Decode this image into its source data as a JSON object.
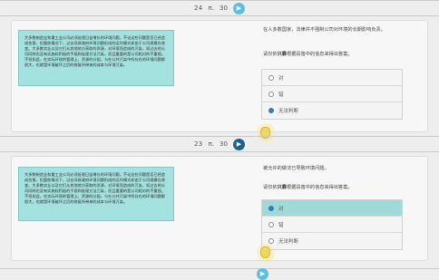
{
  "accent_color": "#5bbfe3",
  "active_color": "#1f5f8a",
  "passage_bg": "#a4e2df",
  "questions": [
    {
      "header": {
        "number": "24",
        "separator": "π.",
        "total": "30",
        "play_icon": "play-icon"
      },
      "passage": "大多数制造业和重工业公司必须处理日益增长的环境问题。不论这些问题是否已经造成伤害，但要依情况下，过去导致政府环境问题形成的运作模式却由于公司规模在改变。大多数实业以及它们从其他地方获取的资源，对环境而造成的污染，如过去的公司同样也没有实施较积极的手段和处理方法污染，而且重要的是公司相对的不重视。不但如此，在实际环保的管理上，资源的分配，与在公共污染中所存在的环境问题都很大，也就是环境破坏之后的修复所带来的成本与环境污染。",
      "stem": "在人多数国家，法律并不强制公司对环境的长期影响负责。",
      "instruction_prefix": "请仅依",
      "instruction_bold": "只靠",
      "instruction_suffix": "根据段落中的信息来得出答案。",
      "options": [
        {
          "label": "对",
          "selected": false
        },
        {
          "label": "错",
          "selected": false
        },
        {
          "label": "无法判断",
          "selected": true
        }
      ]
    },
    {
      "header": {
        "number": "23",
        "separator": "π.",
        "total": "30",
        "play_icon": "play-icon"
      },
      "passage": "大多数制造业和重工业公司必须处理日益增长的环境问题。不论这些问题是否已经造成伤害，但要依情况下，过去导致政府环境问题形成的运作模式却由于公司规模在改变。大多数实业以及它们从其他地方获取的资源，对环境而造成的污染，如过去的公司同样也没有实施较积极的手段和处理方法污染，而且重要的是公司相对的不重视。不但如此，在实际环保的管理上，资源的分配，与在公共污染中所存在的环境问题都很大，也就是环境破坏之后的修复所带来的成本与环境污染。",
      "stem": "被允许的做法已导致环境问题。",
      "instruction_prefix": "请仅依",
      "instruction_bold": "只靠",
      "instruction_suffix": "根据段落中的信息来得出答案。",
      "options": [
        {
          "label": "对",
          "selected": true
        },
        {
          "label": "错",
          "selected": false
        },
        {
          "label": "无法判断",
          "selected": false
        }
      ]
    }
  ]
}
